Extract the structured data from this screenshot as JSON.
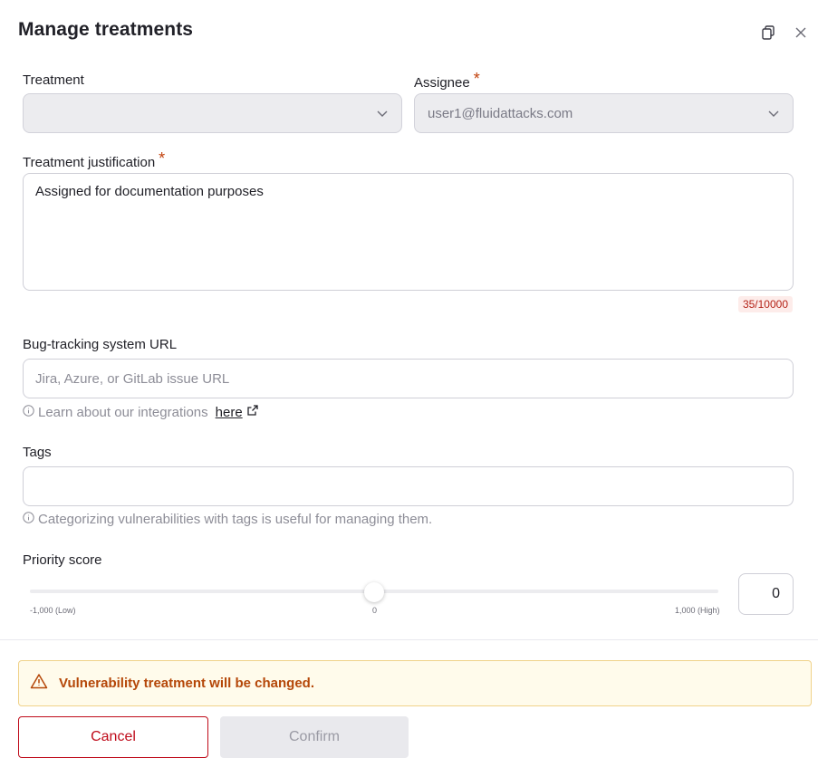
{
  "dialog": {
    "title": "Manage treatments"
  },
  "fields": {
    "treatment": {
      "label": "Treatment",
      "value": ""
    },
    "assignee": {
      "label": "Assignee",
      "required_mark": "*",
      "value": "user1@fluidattacks.com"
    },
    "justification": {
      "label": "Treatment justification",
      "required_mark": "*",
      "value": "Assigned for documentation purposes",
      "counter": "35/10000"
    },
    "bug_url": {
      "label": "Bug-tracking system URL",
      "placeholder": "Jira, Azure, or GitLab issue URL",
      "help_text": "Learn about our integrations",
      "help_link": "here"
    },
    "tags": {
      "label": "Tags",
      "value": "",
      "help_text": "Categorizing vulnerabilities with tags is useful for managing them."
    },
    "priority": {
      "label": "Priority score",
      "min_label": "-1,000 (Low)",
      "mid_label": "0",
      "max_label": "1,000 (High)",
      "value": "0",
      "slider_fraction": 0.5
    }
  },
  "alert": {
    "text": "Vulnerability treatment will be changed."
  },
  "actions": {
    "cancel": "Cancel",
    "confirm": "Confirm"
  },
  "icons": {
    "copy": "copy-icon",
    "close": "close-icon",
    "chevron": "chevron-down-icon",
    "info": "info-icon",
    "external": "external-link-icon",
    "warning": "warning-icon"
  },
  "colors": {
    "required": "#c2410c",
    "cancel": "#bf0b1a",
    "alert_text": "#b54708",
    "alert_bg": "#fffbeb"
  }
}
